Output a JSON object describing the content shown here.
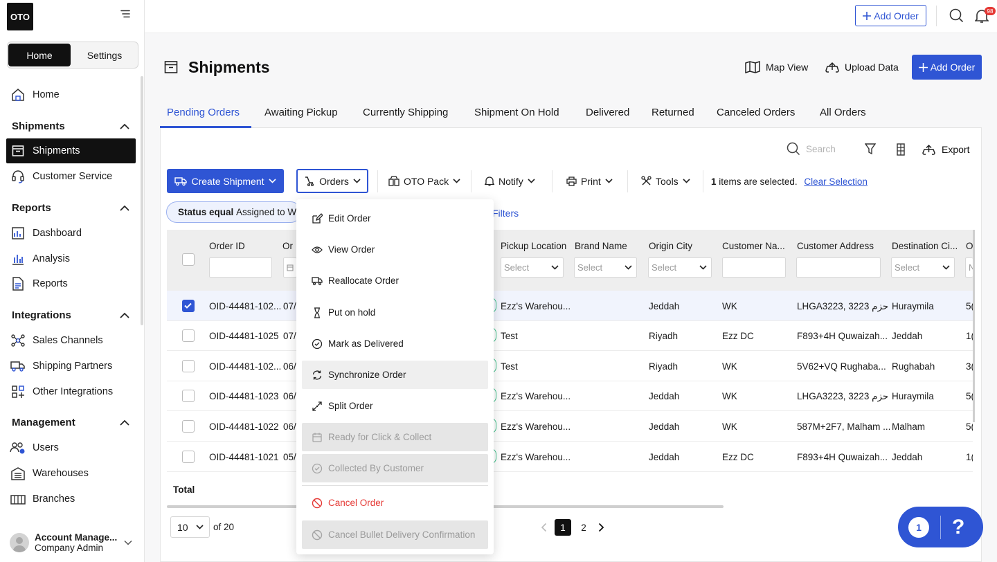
{
  "app": {
    "logo_text": "OTO"
  },
  "sidebar": {
    "segment": {
      "home": "Home",
      "settings": "Settings"
    },
    "home_item": "Home",
    "sections": [
      {
        "title": "Shipments",
        "items": [
          "Shipments",
          "Customer Service"
        ]
      },
      {
        "title": "Reports",
        "items": [
          "Dashboard",
          "Analysis",
          "Reports"
        ]
      },
      {
        "title": "Integrations",
        "items": [
          "Sales Channels",
          "Shipping Partners",
          "Other Integrations"
        ]
      },
      {
        "title": "Management",
        "items": [
          "Users",
          "Warehouses",
          "Branches"
        ]
      }
    ],
    "account": {
      "name": "Account Manage...",
      "role": "Company Admin"
    }
  },
  "topbar": {
    "add_order": "Add Order",
    "notifications_count": "98"
  },
  "header": {
    "title": "Shipments",
    "map_view": "Map View",
    "upload_data": "Upload Data",
    "add_order": "Add Order"
  },
  "tabs": [
    "Pending Orders",
    "Awaiting Pickup",
    "Currently Shipping",
    "Shipment On Hold",
    "Delivered",
    "Returned",
    "Canceled Orders",
    "All Orders"
  ],
  "active_tab": "Pending Orders",
  "toolbar": {
    "search_placeholder": "Search",
    "export": "Export",
    "create_shipment": "Create Shipment",
    "orders": "Orders",
    "oto_pack": "OTO Pack",
    "notify": "Notify",
    "print": "Print",
    "tools": "Tools",
    "selected_count": "1",
    "selected_text": "items are selected.",
    "clear_selection": "Clear Selection"
  },
  "filter_chip": {
    "label": "Status equal",
    "value": "Assigned to W"
  },
  "filters_link": "Filters",
  "table": {
    "headers": {
      "order_id": "Order ID",
      "order_date": "Or",
      "pickup": "Pickup Location",
      "brand": "Brand Name",
      "origin": "Origin City",
      "customer_name": "Customer Na...",
      "customer_address": "Customer Address",
      "destination": "Destination Ci...",
      "next": "O"
    },
    "select_placeholder": "Select",
    "next_placeholder": "N",
    "rows": [
      {
        "checked": true,
        "order_id": "OID-44481-102...",
        "date": "07/",
        "pickup": "Ezz's Warehou...",
        "origin": "Jeddah",
        "customer": "WK",
        "address": "LHGA3223, 3223 حزم",
        "destination": "Huraymila",
        "next": "5("
      },
      {
        "checked": false,
        "order_id": "OID-44481-1025",
        "date": "07/",
        "pickup": "Test",
        "origin": "Riyadh",
        "customer": "Ezz DC",
        "address": "F893+4H Quwaizah...",
        "destination": "Jeddah",
        "next": "1("
      },
      {
        "checked": false,
        "order_id": "OID-44481-102...",
        "date": "06/",
        "pickup": "Test",
        "origin": "Riyadh",
        "customer": "WK",
        "address": "5V62+VQ Rughaba...",
        "destination": "Rughabah",
        "next": "3("
      },
      {
        "checked": false,
        "order_id": "OID-44481-1023",
        "date": "06/",
        "pickup": "Ezz's Warehou...",
        "origin": "Jeddah",
        "customer": "WK",
        "address": "LHGA3223, 3223 حزم",
        "destination": "Huraymila",
        "next": "5("
      },
      {
        "checked": false,
        "order_id": "OID-44481-1022",
        "date": "06/",
        "pickup": "Ezz's Warehou...",
        "origin": "Jeddah",
        "customer": "WK",
        "address": "587M+2F7, Malham ...",
        "destination": "Malham",
        "next": "5("
      },
      {
        "checked": false,
        "order_id": "OID-44481-1021",
        "date": "05/",
        "pickup": "Ezz's Warehou...",
        "origin": "Jeddah",
        "customer": "Ezz DC",
        "address": "F893+4H Quwaizah...",
        "destination": "Jeddah",
        "next": "1("
      }
    ],
    "total_label": "Total"
  },
  "pagination": {
    "page_size": "10",
    "of_text": "of 20",
    "pages": [
      "1",
      "2"
    ],
    "current": "1"
  },
  "orders_menu": [
    {
      "label": "Edit Order",
      "icon": "edit-icon",
      "state": "normal"
    },
    {
      "label": "View Order",
      "icon": "eye-icon",
      "state": "normal"
    },
    {
      "label": "Reallocate Order",
      "icon": "truck-icon",
      "state": "normal"
    },
    {
      "label": "Put on hold",
      "icon": "hourglass-icon",
      "state": "normal"
    },
    {
      "label": "Mark as Delivered",
      "icon": "check-circle-icon",
      "state": "normal"
    },
    {
      "label": "Synchronize Order",
      "icon": "sync-icon",
      "state": "highlighted"
    },
    {
      "label": "Split Order",
      "icon": "split-icon",
      "state": "normal"
    },
    {
      "label": "Ready for Click & Collect",
      "icon": "calendar-icon",
      "state": "disabled"
    },
    {
      "label": "Collected By Customer",
      "icon": "check-circle-icon",
      "state": "disabled"
    },
    {
      "label": "Cancel Order",
      "icon": "ban-icon",
      "state": "danger"
    },
    {
      "label": "Cancel Bullet Delivery Confirmation",
      "icon": "ban-icon",
      "state": "disabled"
    }
  ],
  "help_widget": {
    "count": "1",
    "symbol": "?"
  },
  "colors": {
    "primary": "#2f55d4",
    "danger": "#e53935",
    "sidebar_active": "#111111"
  }
}
